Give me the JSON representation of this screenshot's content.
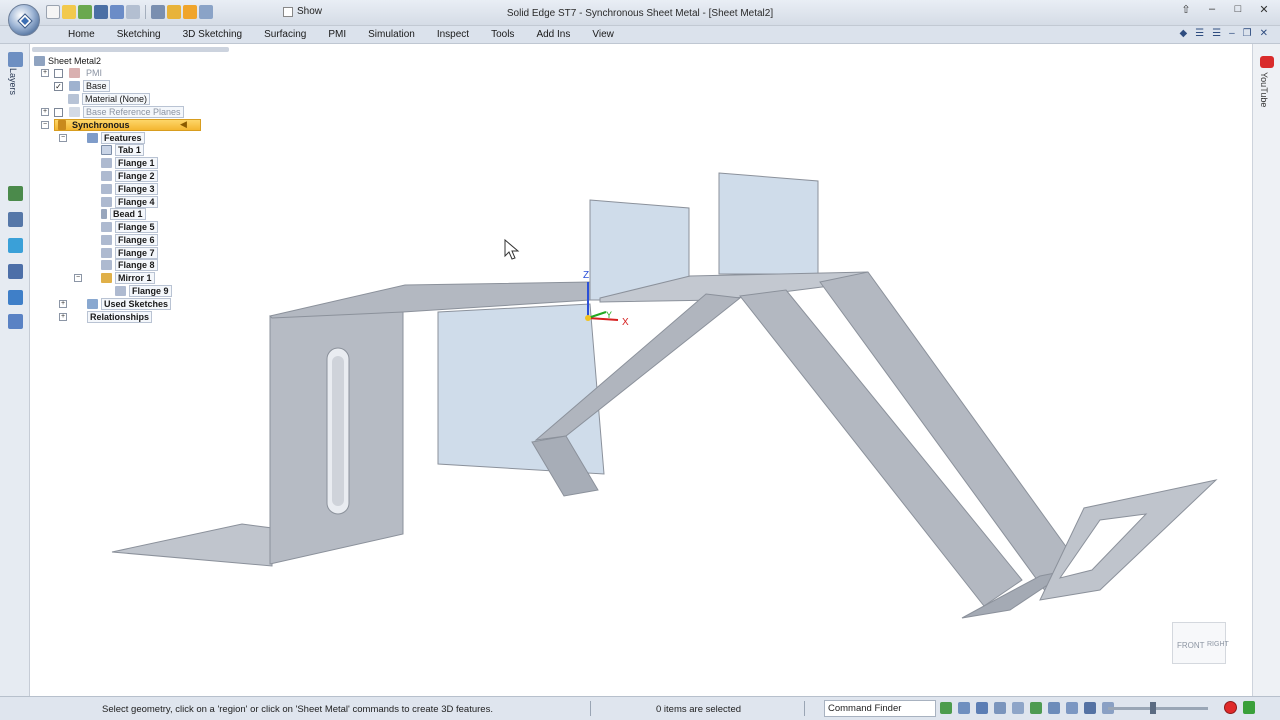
{
  "window": {
    "title": "Solid Edge ST7 - Synchronous Sheet Metal - [Sheet Metal2]",
    "show_label": "Show"
  },
  "ribbon": {
    "tabs": [
      "Home",
      "Sketching",
      "3D Sketching",
      "Surfacing",
      "PMI",
      "Simulation",
      "Inspect",
      "Tools",
      "Add Ins",
      "View"
    ]
  },
  "leftbar": {
    "layers_label": "Layers"
  },
  "rightbar": {
    "youtube_label": "YouTube"
  },
  "tree": {
    "root": "Sheet Metal2",
    "pmi": "PMI",
    "base": "Base",
    "material": "Material (None)",
    "base_ref_planes": "Base Reference Planes",
    "synchronous": "Synchronous",
    "features": "Features",
    "items": [
      "Tab 1",
      "Flange 1",
      "Flange 2",
      "Flange 3",
      "Flange 4",
      "Bead 1",
      "Flange 5",
      "Flange 6",
      "Flange 7",
      "Flange 8",
      "Mirror 1"
    ],
    "mirror_child": "Flange 9",
    "used_sketches": "Used Sketches",
    "relationships": "Relationships"
  },
  "axes": {
    "x": "X",
    "y": "Y",
    "z": "Z"
  },
  "viewcube": {
    "front": "FRONT",
    "right": "RIGHT"
  },
  "status": {
    "message": "Select geometry, click on a 'region' or click on 'Sheet Metal' commands to create 3D features.",
    "selection": "0 items are selected",
    "command_finder": "Command Finder"
  },
  "colors": {
    "part_face": "#b8bdc7",
    "part_light": "#d0d4db",
    "part_dark": "#9ea4ae",
    "selected_feature": "#cfdcea",
    "highlight": "#f4b631"
  }
}
